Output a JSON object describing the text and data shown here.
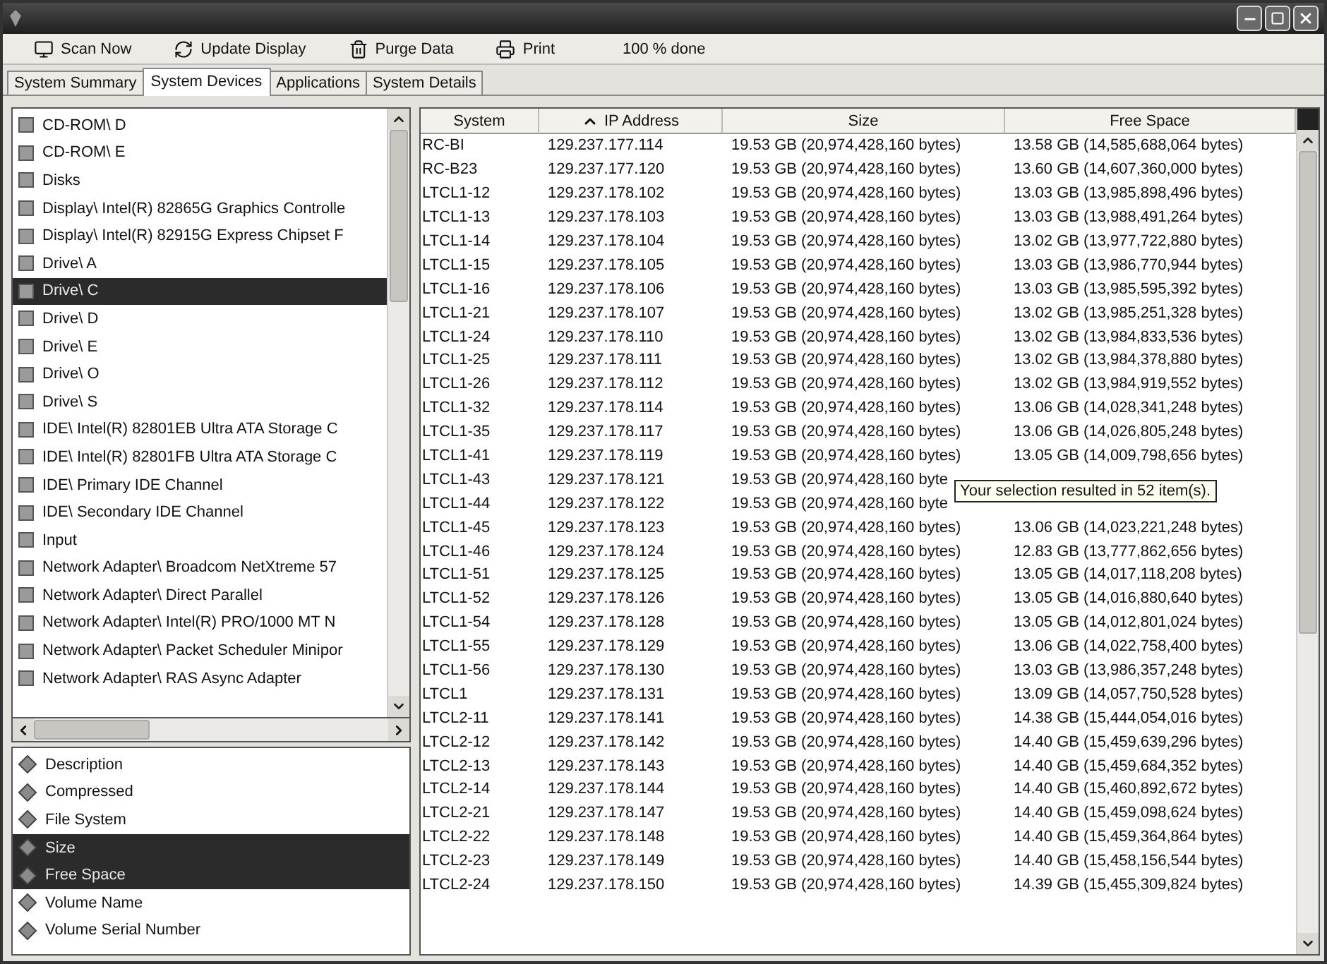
{
  "toolbar": {
    "buttons": [
      {
        "kind": "scan",
        "label": "Scan Now"
      },
      {
        "kind": "update",
        "label": "Update Display"
      },
      {
        "kind": "purge",
        "label": "Purge Data"
      },
      {
        "kind": "print",
        "label": "Print"
      }
    ],
    "status": "100 % done"
  },
  "tabs": [
    {
      "label": "System Summary",
      "selected": false
    },
    {
      "label": "System Devices",
      "selected": true
    },
    {
      "label": "Applications",
      "selected": false
    },
    {
      "label": "System Details",
      "selected": false
    }
  ],
  "devices": [
    {
      "label": "CD-ROM\\ D",
      "selected": false
    },
    {
      "label": "CD-ROM\\ E",
      "selected": false
    },
    {
      "label": "Disks",
      "selected": false
    },
    {
      "label": "Display\\ Intel(R) 82865G Graphics Controlle",
      "selected": false
    },
    {
      "label": "Display\\ Intel(R) 82915G Express Chipset F",
      "selected": false
    },
    {
      "label": "Drive\\ A",
      "selected": false
    },
    {
      "label": "Drive\\ C",
      "selected": true
    },
    {
      "label": "Drive\\ D",
      "selected": false
    },
    {
      "label": "Drive\\ E",
      "selected": false
    },
    {
      "label": "Drive\\ O",
      "selected": false
    },
    {
      "label": "Drive\\ S",
      "selected": false
    },
    {
      "label": "IDE\\ Intel(R) 82801EB Ultra ATA Storage C",
      "selected": false
    },
    {
      "label": "IDE\\ Intel(R) 82801FB Ultra ATA Storage C",
      "selected": false
    },
    {
      "label": "IDE\\ Primary IDE Channel",
      "selected": false
    },
    {
      "label": "IDE\\ Secondary IDE Channel",
      "selected": false
    },
    {
      "label": "Input",
      "selected": false
    },
    {
      "label": "Network Adapter\\ Broadcom NetXtreme 57",
      "selected": false
    },
    {
      "label": "Network Adapter\\ Direct Parallel",
      "selected": false
    },
    {
      "label": "Network Adapter\\ Intel(R) PRO/1000 MT N",
      "selected": false
    },
    {
      "label": "Network Adapter\\ Packet Scheduler Minipor",
      "selected": false
    },
    {
      "label": "Network Adapter\\ RAS Async Adapter",
      "selected": false
    }
  ],
  "properties": [
    {
      "label": "Description",
      "selected": false
    },
    {
      "label": "Compressed",
      "selected": false
    },
    {
      "label": "File System",
      "selected": false
    },
    {
      "label": "Size",
      "selected": true
    },
    {
      "label": "Free Space",
      "selected": true
    },
    {
      "label": "Volume Name",
      "selected": false
    },
    {
      "label": "Volume Serial Number",
      "selected": false
    }
  ],
  "table": {
    "columns": [
      {
        "label": "System",
        "sorted": false
      },
      {
        "label": "IP Address",
        "sorted": true
      },
      {
        "label": "Size",
        "sorted": false
      },
      {
        "label": "Free Space",
        "sorted": false
      }
    ],
    "rows": [
      [
        "RC-BI",
        "129.237.177.114",
        "19.53 GB (20,974,428,160 bytes)",
        "13.58 GB (14,585,688,064 bytes)"
      ],
      [
        "RC-B23",
        "129.237.177.120",
        "19.53 GB (20,974,428,160 bytes)",
        "13.60 GB (14,607,360,000 bytes)"
      ],
      [
        "LTCL1-12",
        "129.237.178.102",
        "19.53 GB (20,974,428,160 bytes)",
        "13.03 GB (13,985,898,496 bytes)"
      ],
      [
        "LTCL1-13",
        "129.237.178.103",
        "19.53 GB (20,974,428,160 bytes)",
        "13.03 GB (13,988,491,264 bytes)"
      ],
      [
        "LTCL1-14",
        "129.237.178.104",
        "19.53 GB (20,974,428,160 bytes)",
        "13.02 GB (13,977,722,880 bytes)"
      ],
      [
        "LTCL1-15",
        "129.237.178.105",
        "19.53 GB (20,974,428,160 bytes)",
        "13.03 GB (13,986,770,944 bytes)"
      ],
      [
        "LTCL1-16",
        "129.237.178.106",
        "19.53 GB (20,974,428,160 bytes)",
        "13.03 GB (13,985,595,392 bytes)"
      ],
      [
        "LTCL1-21",
        "129.237.178.107",
        "19.53 GB (20,974,428,160 bytes)",
        "13.02 GB (13,985,251,328 bytes)"
      ],
      [
        "LTCL1-24",
        "129.237.178.110",
        "19.53 GB (20,974,428,160 bytes)",
        "13.02 GB (13,984,833,536 bytes)"
      ],
      [
        "LTCL1-25",
        "129.237.178.111",
        "19.53 GB (20,974,428,160 bytes)",
        "13.02 GB (13,984,378,880 bytes)"
      ],
      [
        "LTCL1-26",
        "129.237.178.112",
        "19.53 GB (20,974,428,160 bytes)",
        "13.02 GB (13,984,919,552 bytes)"
      ],
      [
        "LTCL1-32",
        "129.237.178.114",
        "19.53 GB (20,974,428,160 bytes)",
        "13.06 GB (14,028,341,248 bytes)"
      ],
      [
        "LTCL1-35",
        "129.237.178.117",
        "19.53 GB (20,974,428,160 bytes)",
        "13.06 GB (14,026,805,248 bytes)"
      ],
      [
        "LTCL1-41",
        "129.237.178.119",
        "19.53 GB (20,974,428,160 bytes)",
        "13.05 GB (14,009,798,656 bytes)"
      ],
      [
        "LTCL1-43",
        "129.237.178.121",
        "19.53 GB (20,974,428,160 byte"
      ],
      [
        "LTCL1-44",
        "129.237.178.122",
        "19.53 GB (20,974,428,160 byte"
      ],
      [
        "LTCL1-45",
        "129.237.178.123",
        "19.53 GB (20,974,428,160 bytes)",
        "13.06 GB (14,023,221,248 bytes)"
      ],
      [
        "LTCL1-46",
        "129.237.178.124",
        "19.53 GB (20,974,428,160 bytes)",
        "12.83 GB (13,777,862,656 bytes)"
      ],
      [
        "LTCL1-51",
        "129.237.178.125",
        "19.53 GB (20,974,428,160 bytes)",
        "13.05 GB (14,017,118,208 bytes)"
      ],
      [
        "LTCL1-52",
        "129.237.178.126",
        "19.53 GB (20,974,428,160 bytes)",
        "13.05 GB (14,016,880,640 bytes)"
      ],
      [
        "LTCL1-54",
        "129.237.178.128",
        "19.53 GB (20,974,428,160 bytes)",
        "13.05 GB (14,012,801,024 bytes)"
      ],
      [
        "LTCL1-55",
        "129.237.178.129",
        "19.53 GB (20,974,428,160 bytes)",
        "13.06 GB (14,022,758,400 bytes)"
      ],
      [
        "LTCL1-56",
        "129.237.178.130",
        "19.53 GB (20,974,428,160 bytes)",
        "13.03 GB (13,986,357,248 bytes)"
      ],
      [
        "LTCL1",
        "129.237.178.131",
        "19.53 GB (20,974,428,160 bytes)",
        "13.09 GB (14,057,750,528 bytes)"
      ],
      [
        "LTCL2-11",
        "129.237.178.141",
        "19.53 GB (20,974,428,160 bytes)",
        "14.38 GB (15,444,054,016 bytes)"
      ],
      [
        "LTCL2-12",
        "129.237.178.142",
        "19.53 GB (20,974,428,160 bytes)",
        "14.40 GB (15,459,639,296 bytes)"
      ],
      [
        "LTCL2-13",
        "129.237.178.143",
        "19.53 GB (20,974,428,160 bytes)",
        "14.40 GB (15,459,684,352 bytes)"
      ],
      [
        "LTCL2-14",
        "129.237.178.144",
        "19.53 GB (20,974,428,160 bytes)",
        "14.40 GB (15,460,892,672 bytes)"
      ],
      [
        "LTCL2-21",
        "129.237.178.147",
        "19.53 GB (20,974,428,160 bytes)",
        "14.40 GB (15,459,098,624 bytes)"
      ],
      [
        "LTCL2-22",
        "129.237.178.148",
        "19.53 GB (20,974,428,160 bytes)",
        "14.40 GB (15,459,364,864 bytes)"
      ],
      [
        "LTCL2-23",
        "129.237.178.149",
        "19.53 GB (20,974,428,160 bytes)",
        "14.40 GB (15,458,156,544 bytes)"
      ],
      [
        "LTCL2-24",
        "129.237.178.150",
        "19.53 GB (20,974,428,160 bytes)",
        "14.39 GB (15,455,309,824 bytes)"
      ]
    ]
  },
  "tooltip": "Your selection resulted in 52 item(s)."
}
